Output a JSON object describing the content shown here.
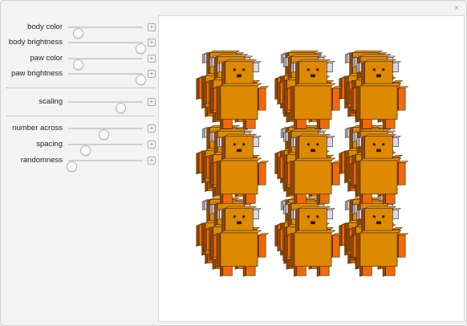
{
  "window": {
    "close_glyph": "×"
  },
  "controls": [
    {
      "label": "body color",
      "value": 0.13
    },
    {
      "label": "body brightness",
      "value": 0.97
    },
    {
      "label": "paw color",
      "value": 0.13
    },
    {
      "label": "paw brightness",
      "value": 0.97
    },
    {
      "label": "scaling",
      "value": 0.7
    },
    {
      "label": "number across",
      "value": 0.47
    },
    {
      "label": "spacing",
      "value": 0.23
    },
    {
      "label": "randomness",
      "value": 0.04
    }
  ],
  "colors": {
    "body_front": "#dd8a00",
    "body_side": "#8f4800",
    "body_top": "#e39421",
    "paw": "#f26a05",
    "ear": "#d9d5ee",
    "ear_edge": "#b0acc8",
    "face": "#2b1400",
    "outline": "#3a2000"
  },
  "icons": {
    "slider_plus": "plus-square-icon",
    "close": "close-icon"
  }
}
